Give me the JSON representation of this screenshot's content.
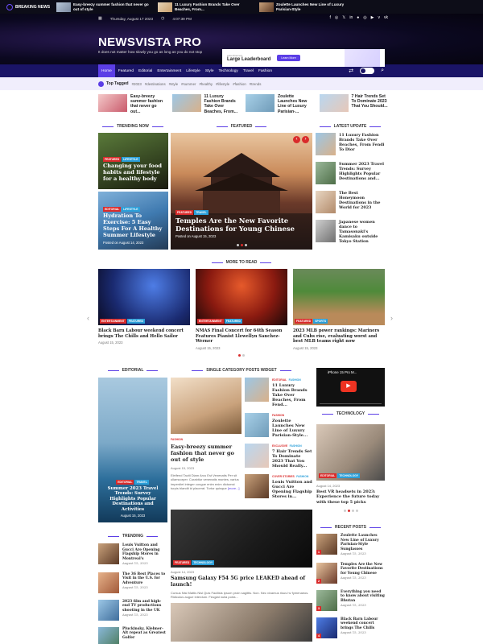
{
  "topbar": {
    "breaking_label": "BREAKING NEWS",
    "ticker": [
      "Easy-breezy summer fashion that never go out of style",
      "11 Luxury Fashion Brands Take Over Beaches, From...",
      "Zoulette Launches New Line of Luxury Parisian-Style"
    ]
  },
  "header": {
    "date": "Thursday, August 17 2023",
    "time": "4:07:39 PM",
    "social": [
      "f",
      "◎",
      "𝕏",
      "in",
      "●",
      "◎",
      "▶",
      "v",
      "vk"
    ],
    "logo_title": "NEWSVISTA PRO",
    "logo_tagline": "It does not matter how slowly you go as long as you do not stop",
    "ad_small": "Advertisement",
    "ad_title": "Large Leaderboard",
    "ad_button": "Learn More"
  },
  "nav": {
    "items": [
      "Home",
      "Featured",
      "Editorial",
      "Entertainment",
      "Lifestyle",
      "Style",
      "Technology",
      "Travel",
      "Fashion"
    ]
  },
  "tags": {
    "label": "Top Tagged",
    "items": [
      "#2023",
      "#destinations",
      "#style",
      "#summer",
      "#healthy",
      "#lifestyle",
      "#fashion",
      "#trends"
    ]
  },
  "strip": [
    "Easy-breezy summer fashion that never go out...",
    "11 Luxury Fashion Brands Take Over Beaches, From...",
    "Zoulette Launches New Line of Luxury Parisian-...",
    "7 Hair Trends Set To Dominate 2023 That You Should..."
  ],
  "sections": {
    "trending_now": "TRENDING NOW",
    "featured": "FEATURED",
    "latest_update": "LATEST UPDATE",
    "more_to_read": "MORE TO READ",
    "editorial": "EDITORIAL",
    "single_category": "SINGLE CATEGORY POSTS WIDGET",
    "technology": "TECHNOLOGY",
    "trending": "TRENDING",
    "recent_posts": "RECENT POSTS"
  },
  "trending_now": [
    {
      "badges": [
        "FEATURED",
        "LIFESTYLE"
      ],
      "title": "Changing your food habits and lifestyle for a healthy body",
      "date": ""
    },
    {
      "badges": [
        "EDITORIAL",
        "LIFESTYLE"
      ],
      "title": "Hydration To Exercise: 5 Easy Steps For A Healthy Summer Lifestyle",
      "date": "Posted on August 14, 2023"
    }
  ],
  "featured": {
    "badges": [
      "FEATURED",
      "TRAVEL"
    ],
    "title": "Temples Are the New Favorite Destinations for Young Chinese",
    "date": "Posted on August 15, 2023"
  },
  "latest": [
    "11 Luxury Fashion Brands Take Over Beaches, From Fendi To Dior",
    "Summer 2023 Travel Trends: Survey Highlights Popular Destinations and...",
    "The Best Honeymoon Destinations in the World for 2023",
    "Japanese women dance to Tamasonaki's Kamisaku outside Tokyo Station"
  ],
  "more_to_read": [
    {
      "badges": [
        "ENTERTAINMENT",
        "FEATURED"
      ],
      "title": "Black Barn Labour weekend concert brings The Chills and Hello Sailor",
      "date": "August 15, 2023"
    },
    {
      "badges": [
        "ENTERTAINMENT",
        "FEATURED"
      ],
      "title": "NMAS Final Concert for 64th Season Features Pianist Llewellyn Sanchez-Werner",
      "date": "August 15, 2023"
    },
    {
      "badges": [
        "FEATURED",
        "SPORTS"
      ],
      "title": "2023 MLB power rankings: Mariners and Cubs rise, evaluating worst and best MLB teams right now",
      "date": "August 15, 2023"
    }
  ],
  "editorial": {
    "badges": [
      "EDITORIAL",
      "TRAVEL"
    ],
    "title": "Summer 2023 Travel Trends: Survey Highlights Popular Destinations and Activities",
    "date": "August 15, 2023"
  },
  "single_main": {
    "badge": "FASHION",
    "title": "Easy-breezy summer fashion that never go out of style",
    "date": "August 15, 2023",
    "excerpt": "Eleifend Taciti Diam Arcu Est Venenatis Per sit ullamcorper. Curabitur venenatis montes, varius imperdiet integer congue enim enim dictumst turpis blandit id placerat. Tortor quisque",
    "more": "[more...]"
  },
  "single_list": [
    {
      "badges": [
        "EDITORIAL",
        "FASHION"
      ],
      "title": "11 Luxury Fashion Brands Take Over Beaches, From Fend...",
      "date": "August 15, 2023"
    },
    {
      "badges": [
        "FASHION"
      ],
      "title": "Zoulette Launches New Line of Luxury Parisian-Style...",
      "date": "August 15, 2023"
    },
    {
      "badges": [
        "EXCLUSIVE",
        "FASHION"
      ],
      "title": "7 Hair Trends Set To Dominate 2023 That You Should Really...",
      "date": "August 15, 2023"
    },
    {
      "badges": [
        "COVER STORIES",
        "FASHION"
      ],
      "title": "Louis Vuitton and Gucci Are Opening Flagship Stores in...",
      "date": "August 15, 2023"
    }
  ],
  "samsung": {
    "badges": [
      "FEATURED",
      "TECHNOLOGY"
    ],
    "date": "August 14, 2023",
    "title": "Samsung Galaxy F54 5G price LEAKED ahead of launch!",
    "excerpt": "Cursus Nisi Mattis Nisl Quis Facilisis ipsum proin sagittis. Non. Nec vivamus risus hv fymenaeos. Ridiculus augue interdum. Feugiat nulla porta..."
  },
  "video": {
    "title": "iPhone 15 Pro M...",
    "channel_hint": "15 Pro Max"
  },
  "technology": {
    "badges": [
      "EDITORIAL",
      "TECHNOLOGY"
    ],
    "date": "August 14, 2023",
    "title": "Best VR headsets in 2023: Experience the future today with these top 5 picks"
  },
  "trending_list": [
    {
      "title": "Louis Vuitton and Gucci Are Opening Flagship Stores in Montreal's",
      "date": "August 15, 2023"
    },
    {
      "title": "The 36 Best Places to Visit in the U.S. for Adventure",
      "date": "August 15, 2023"
    },
    {
      "title": "2023 film and high-end TV productions shooting in the UK",
      "date": "August 15, 2023"
    },
    {
      "title": "Pluckinsky, Klebner-Alt repeat as Greatest Golfer",
      "date": ""
    }
  ],
  "recent_posts": [
    {
      "num": "1",
      "title": "Zoulette Launches New Line of Luxury Parisian-Style Sunglasses",
      "date": "August 15, 2023"
    },
    {
      "num": "2",
      "title": "Temples Are the New Favorite Destinations for Young Chinese",
      "date": "August 15, 2023"
    },
    {
      "num": "3",
      "title": "Everything you need to know about visiting Bhutan",
      "date": "August 15, 2023"
    },
    {
      "num": "4",
      "title": "Black Barn Labour weekend concert brings The Chills",
      "date": "August 15, 2023"
    }
  ],
  "colors": {
    "accent": "#5b3ee6",
    "nav_bg": "#1a1466",
    "red": "#d92b2b",
    "blue": "#2b9fd9"
  }
}
